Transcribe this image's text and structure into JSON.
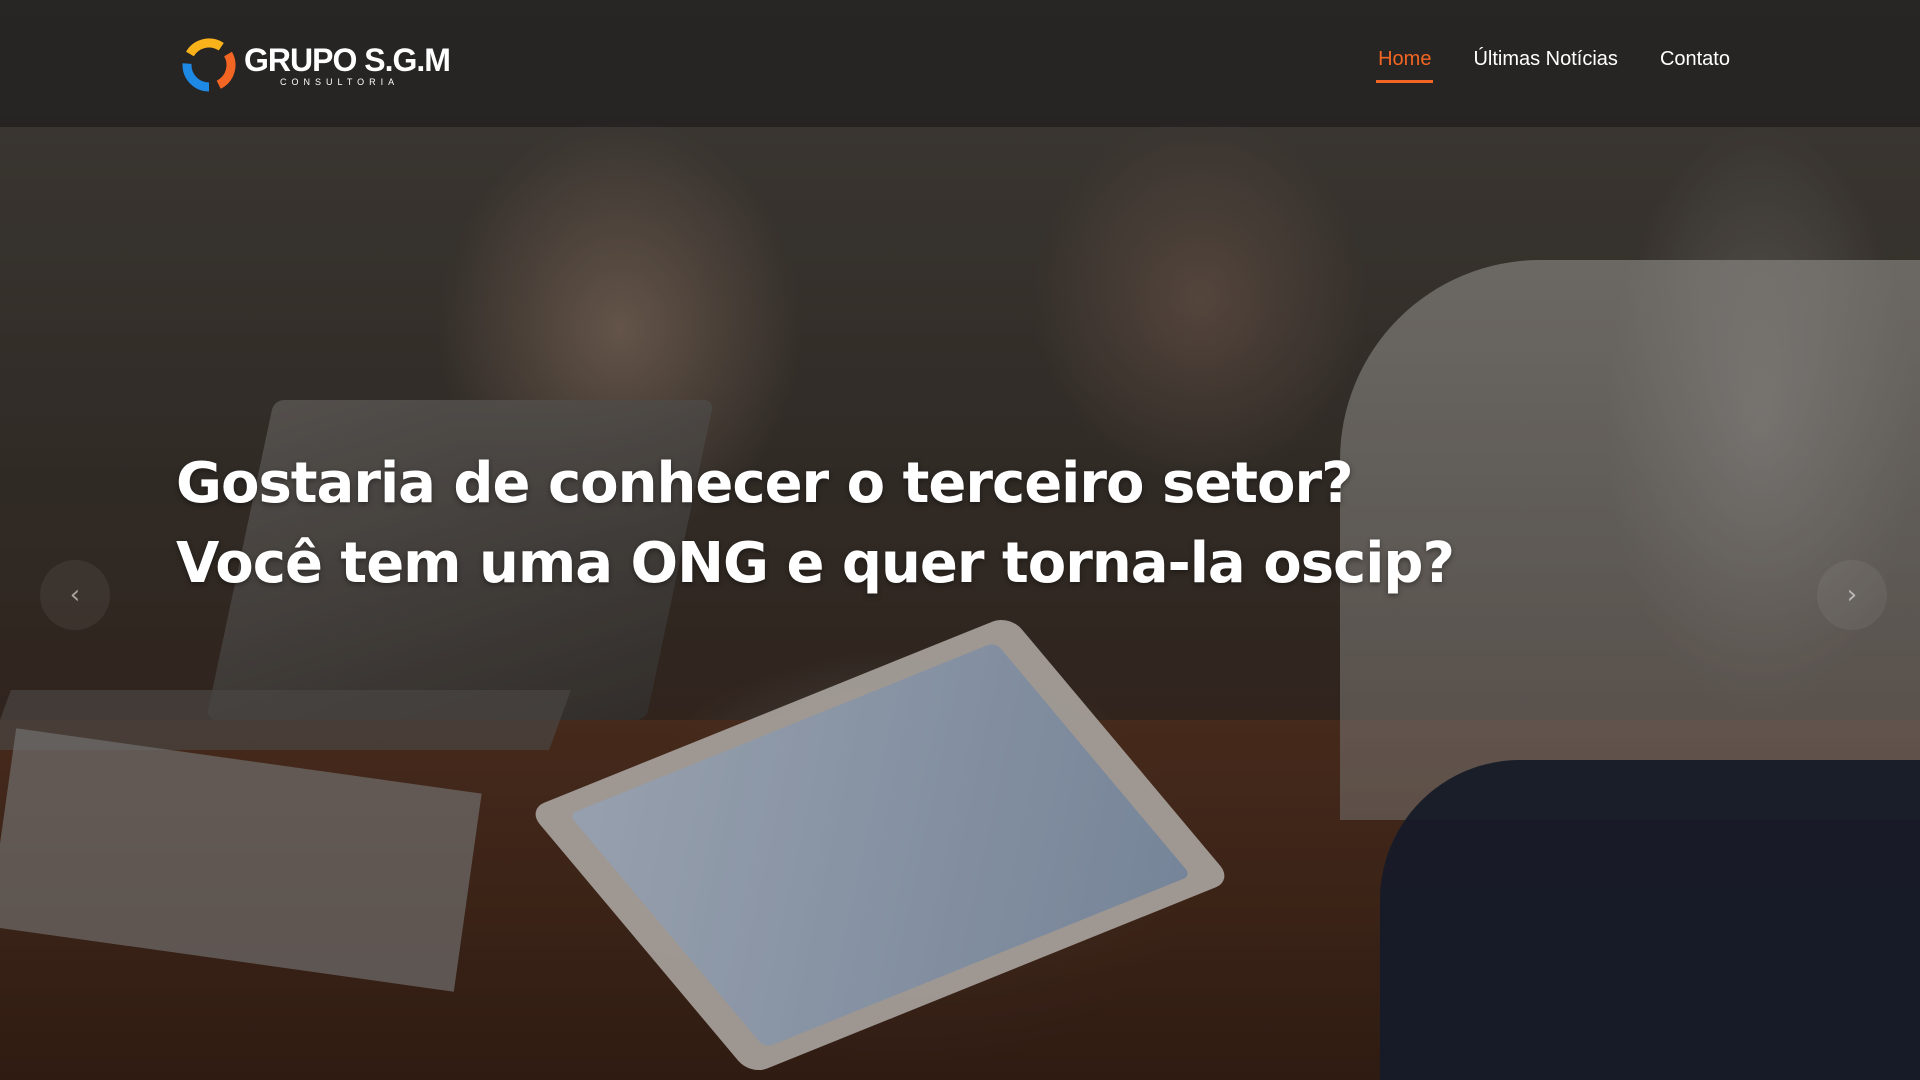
{
  "header": {
    "logo": {
      "title": "GRUPO S.G.M",
      "subtitle": "CONSULTORIA"
    },
    "nav": [
      {
        "label": "Home",
        "active": true
      },
      {
        "label": "Últimas Notícias",
        "active": false
      },
      {
        "label": "Contato",
        "active": false
      }
    ]
  },
  "hero": {
    "line1": "Gostaria de conhecer o terceiro setor?",
    "line2": "Você tem uma ONG e quer torna-la oscip?"
  },
  "carousel": {
    "prev_icon": "chevron-left-icon",
    "next_icon": "chevron-right-icon",
    "prev_symbol": "‹",
    "next_symbol": "›"
  },
  "colors": {
    "accent": "#f26522",
    "header_bg": "rgba(30,30,30,0.72)",
    "text": "#ffffff"
  }
}
